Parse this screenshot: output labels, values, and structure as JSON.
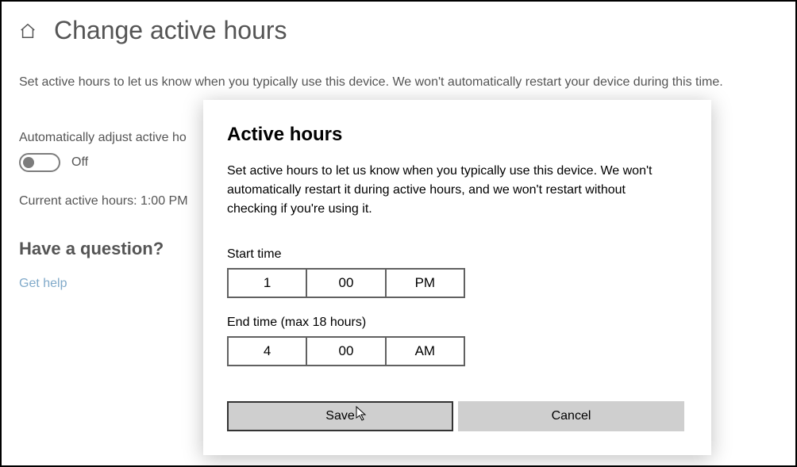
{
  "page": {
    "title": "Change active hours",
    "description": "Set active hours to let us know when you typically use this device. We won't automatically restart your device during this time.",
    "auto_adjust_label": "Automatically adjust active ho",
    "toggle_state_label": "Off",
    "current_hours_label": "Current active hours: 1:00 PM",
    "question_heading": "Have a question?",
    "help_link": "Get help"
  },
  "dialog": {
    "title": "Active hours",
    "body": "Set active hours to let us know when you typically use this device. We won't automatically restart it during active hours, and we won't restart without checking if you're using it.",
    "start_label": "Start time",
    "start": {
      "hour": "1",
      "minute": "00",
      "ampm": "PM"
    },
    "end_label": "End time (max 18 hours)",
    "end": {
      "hour": "4",
      "minute": "00",
      "ampm": "AM"
    },
    "save_label": "Save",
    "cancel_label": "Cancel"
  }
}
